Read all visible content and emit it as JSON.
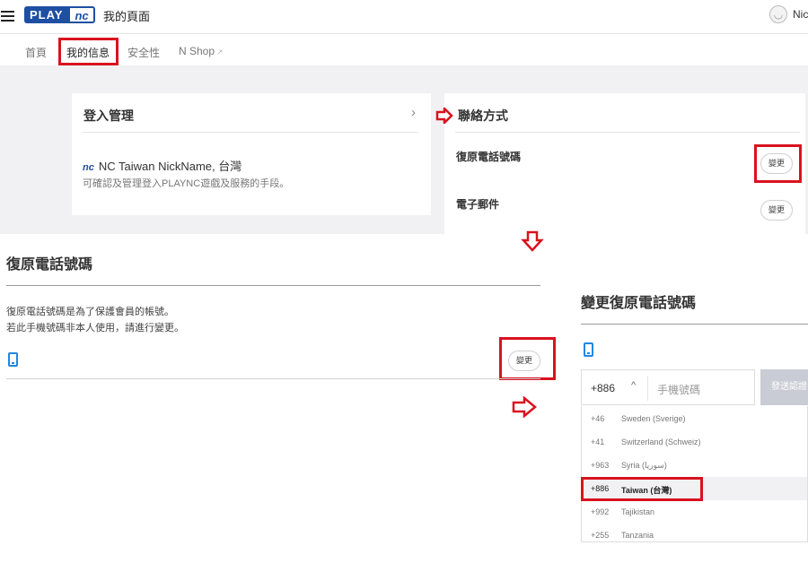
{
  "header": {
    "logo_play": "PLAY",
    "logo_nc": "nc",
    "page_title": "我的頁面",
    "user_name": "Nic"
  },
  "tabs": [
    {
      "label": "首頁"
    },
    {
      "label": "我的信息"
    },
    {
      "label": "安全性"
    },
    {
      "label": "N Shop"
    }
  ],
  "login_card": {
    "title": "登入管理",
    "account_badge": "nc",
    "account_name": "NC Taiwan NickName,  台灣",
    "description": "可確認及管理登入PLAYNC遊戲及服務的手段。"
  },
  "contact_card": {
    "title": "聯絡方式",
    "recovery_phone_label": "復原電話號碼",
    "email_label": "電子郵件",
    "change_label": "變更"
  },
  "recovery_panel": {
    "title": "復原電話號碼",
    "line1": "復原電話號碼是為了保護會員的帳號。",
    "line2": "若此手機號碼非本人使用，請進行變更。",
    "change_label": "變更"
  },
  "change_panel": {
    "title": "變更復原電話號碼",
    "country_code": "+886",
    "phone_placeholder": "手機號碼",
    "send_label": "發送認證"
  },
  "country_options": [
    {
      "code": "+46",
      "name": "Sweden (Sverige)"
    },
    {
      "code": "+41",
      "name": "Switzerland (Schweiz)"
    },
    {
      "code": "+963",
      "name": "Syria (سوريا)"
    },
    {
      "code": "+886",
      "name": "Taiwan (台灣)"
    },
    {
      "code": "+992",
      "name": "Tajikistan"
    },
    {
      "code": "+255",
      "name": "Tanzania"
    }
  ],
  "colors": {
    "brand_blue": "#1e4fa3",
    "highlight_red": "#d9121f",
    "phone_icon_blue": "#1e88e5"
  }
}
